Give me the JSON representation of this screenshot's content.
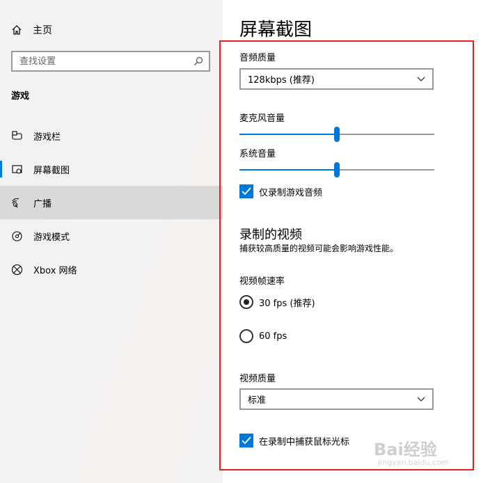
{
  "sidebar": {
    "home_label": "主页",
    "search_placeholder": "查找设置",
    "section_title": "游戏",
    "items": [
      {
        "label": "游戏栏",
        "icon": "game-bar-icon"
      },
      {
        "label": "屏幕截图",
        "icon": "capture-icon"
      },
      {
        "label": "广播",
        "icon": "broadcast-icon"
      },
      {
        "label": "游戏模式",
        "icon": "game-mode-icon"
      },
      {
        "label": "Xbox 网络",
        "icon": "xbox-icon"
      }
    ],
    "selected_index": 2,
    "active_index": 1
  },
  "main": {
    "page_title": "屏幕截图",
    "audio_quality": {
      "label": "音频质量",
      "value": "128kbps (推荐)"
    },
    "mic_volume": {
      "label": "麦克风音量",
      "value_fraction": 0.5
    },
    "system_volume": {
      "label": "系统音量",
      "value_fraction": 0.5
    },
    "game_audio_only": {
      "label": "仅录制游戏音频",
      "checked": true
    },
    "video_section": {
      "title": "录制的视频",
      "description": "捕获较高质量的视频可能会影响游戏性能。"
    },
    "frame_rate": {
      "label": "视频帧速率",
      "options": [
        "30 fps (推荐)",
        "60 fps"
      ],
      "selected": 0
    },
    "video_quality": {
      "label": "视频质量",
      "value": "标准"
    },
    "capture_cursor": {
      "label": "在录制中捕获鼠标光标",
      "checked": true
    }
  },
  "watermark": {
    "text": "Bai经验",
    "sub": "jingyan.baidu.com"
  },
  "colors": {
    "accent": "#0078d7",
    "highlight_box": "#e1221f",
    "sidebar_bg": "#f2f2f2",
    "selected_bg": "#d9d9d9"
  }
}
